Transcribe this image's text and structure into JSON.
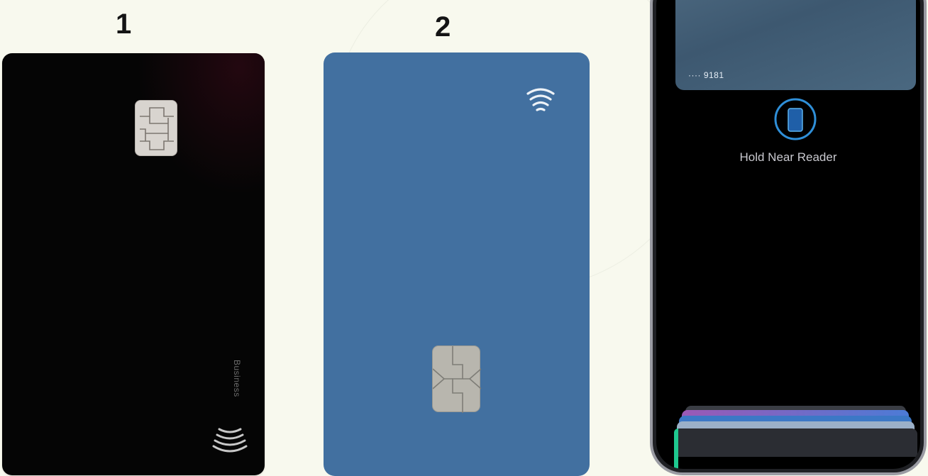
{
  "labels": {
    "card_one_number": "1",
    "card_two_number": "2"
  },
  "card_one": {
    "type_label": "Business",
    "color": "#050505"
  },
  "card_two": {
    "color": "#4270a0"
  },
  "phone": {
    "card_digits": "···· 9181",
    "prompt": "Hold Near Reader",
    "icons": [
      "contactless-icon",
      "phone-tap-icon"
    ]
  }
}
